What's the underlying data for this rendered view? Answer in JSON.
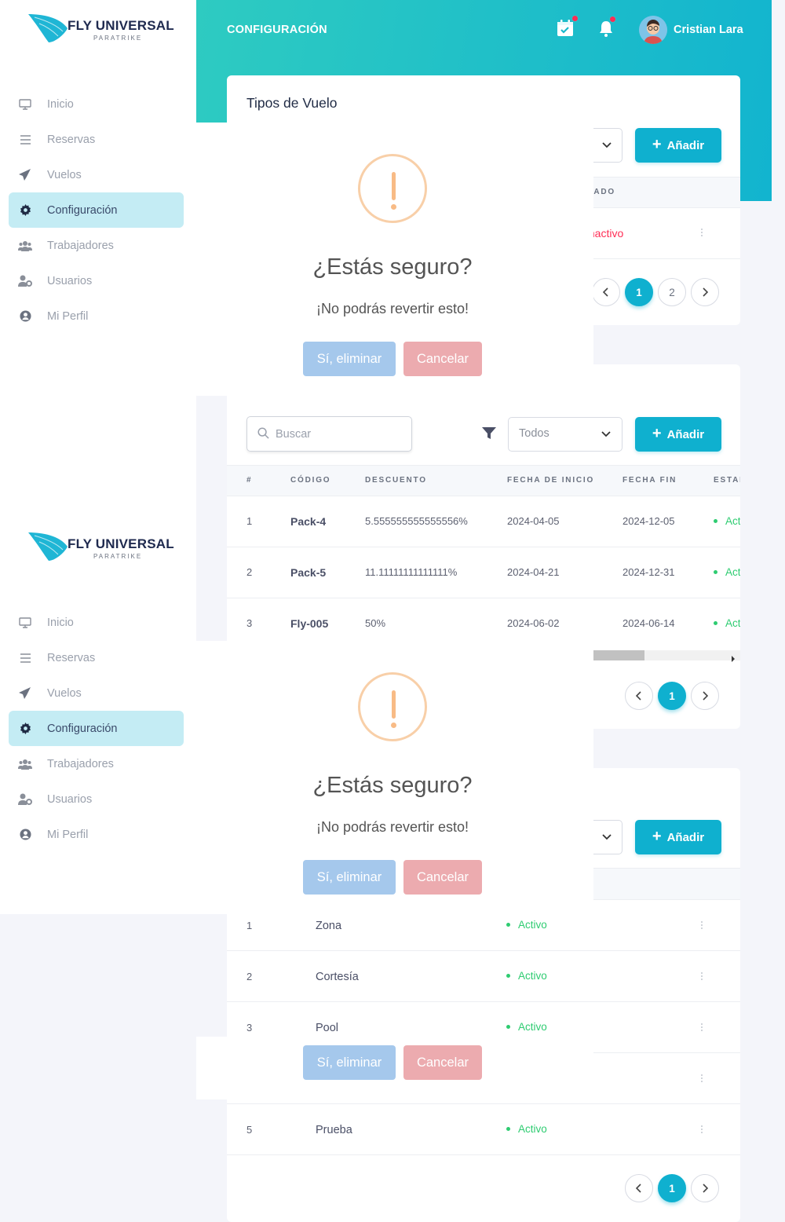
{
  "brand": {
    "title": "FLY UNIVERSAL",
    "subtitle": "PARATRIKE"
  },
  "sidebar": {
    "items": [
      {
        "label": "Inicio",
        "icon": "monitor-icon"
      },
      {
        "label": "Reservas",
        "icon": "list-icon"
      },
      {
        "label": "Vuelos",
        "icon": "paper-plane-icon"
      },
      {
        "label": "Configuración",
        "icon": "gear-icon",
        "active": true
      },
      {
        "label": "Trabajadores",
        "icon": "users-icon"
      },
      {
        "label": "Usuarios",
        "icon": "user-cog-icon"
      },
      {
        "label": "Mi Perfil",
        "icon": "user-circle-icon"
      }
    ]
  },
  "header": {
    "title": "CONFIGURACIÓN",
    "user_name": "Cristian Lara"
  },
  "colors": {
    "accent": "#0fb0cf",
    "gradient_start": "#2ecbc1",
    "active_bg": "#c4ecf4",
    "danger": "#ff2d55",
    "success": "#2ecc71"
  },
  "card1": {
    "title": "Tipos de Vuelo",
    "add_label": "Añadir",
    "status_header": "ESTADO",
    "status_value": "Inactivo",
    "pages": [
      "1",
      "2"
    ]
  },
  "card2": {
    "search_placeholder": "Buscar",
    "filter_value": "Todos",
    "add_label": "Añadir",
    "columns": [
      "#",
      "CÓDIGO",
      "DESCUENTO",
      "FECHA DE INICIO",
      "FECHA FIN",
      "ESTADO"
    ],
    "rows": [
      {
        "n": "1",
        "code": "Pack-4",
        "discount": "5.555555555555556%",
        "start": "2024-04-05",
        "end": "2024-12-05",
        "status": "Activo"
      },
      {
        "n": "2",
        "code": "Pack-5",
        "discount": "11.11111111111111%",
        "start": "2024-04-21",
        "end": "2024-12-31",
        "status": "Activo"
      },
      {
        "n": "3",
        "code": "Fly-005",
        "discount": "50%",
        "start": "2024-06-02",
        "end": "2024-06-14",
        "status": "Activo"
      }
    ],
    "pages": [
      "1"
    ]
  },
  "card3": {
    "add_label": "Añadir",
    "rows": [
      {
        "n": "1",
        "name": "Zona",
        "status": "Activo"
      },
      {
        "n": "2",
        "name": "Cortesía",
        "status": "Activo"
      },
      {
        "n": "3",
        "name": "Pool",
        "status": "Activo"
      },
      {
        "n": "5",
        "name": "Prueba",
        "status": "Activo"
      }
    ],
    "pages": [
      "1"
    ]
  },
  "modal": {
    "title": "¿Estás seguro?",
    "text": "¡No podrás revertir esto!",
    "confirm_label": "Sí, eliminar",
    "cancel_label": "Cancelar"
  }
}
